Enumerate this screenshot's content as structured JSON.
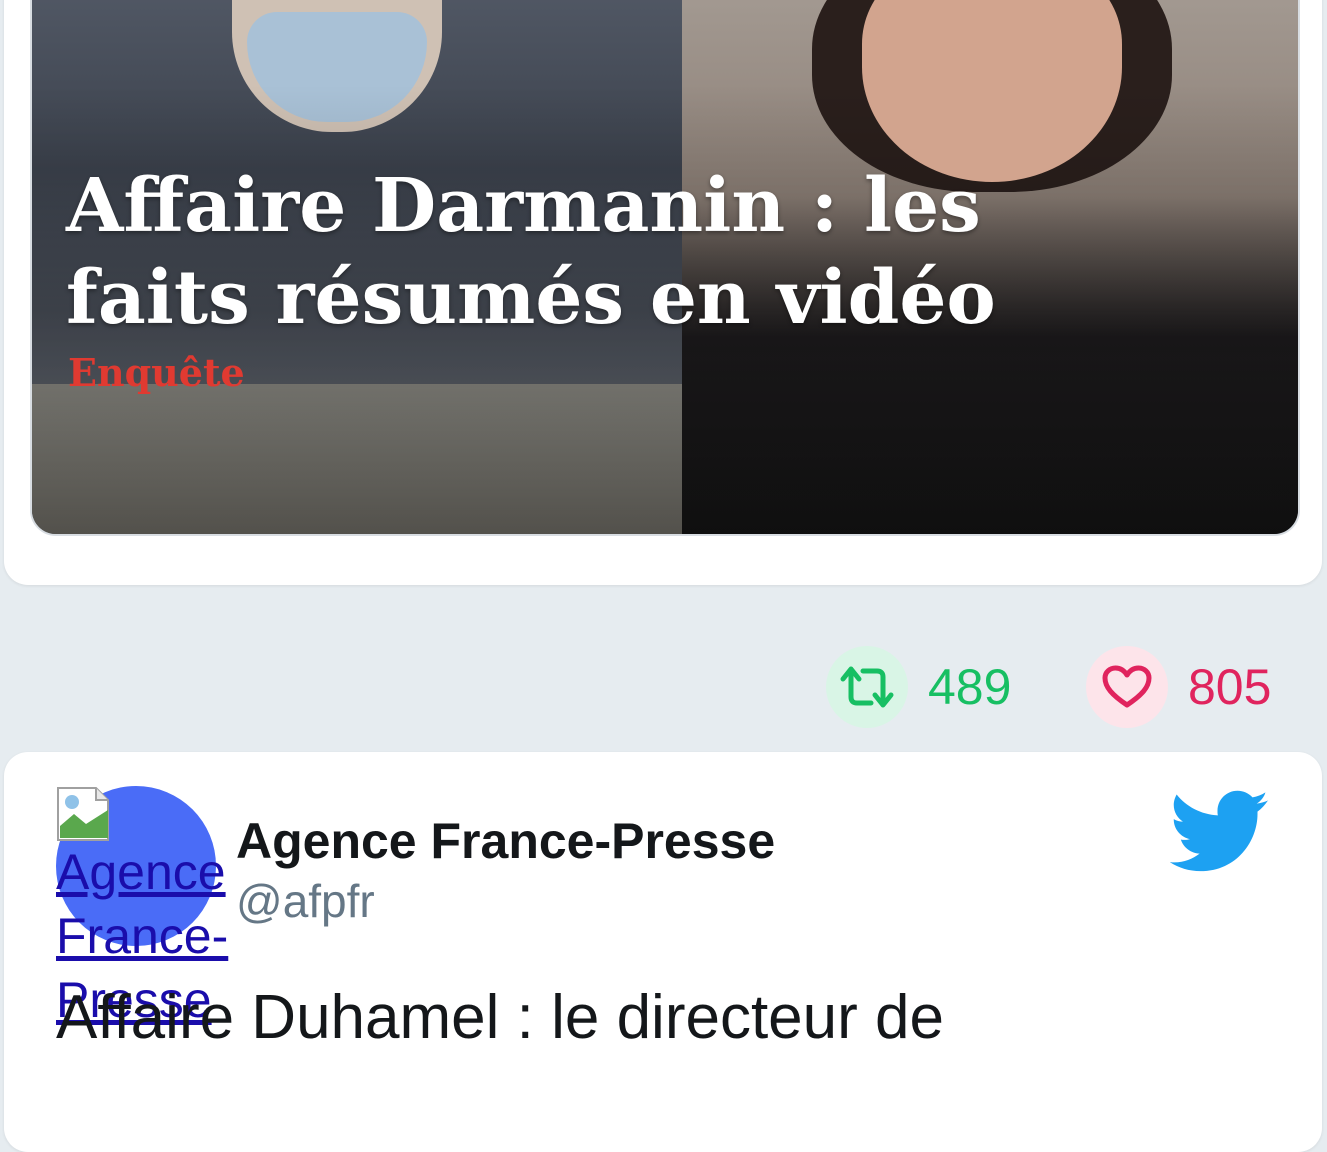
{
  "media": {
    "title": "Affaire Darmanin : les faits résumés en vidéo",
    "tag": "Enquête"
  },
  "actions": {
    "retweet_count": "489",
    "like_count": "805"
  },
  "tweet": {
    "avatar_alt": "Agence France-Presse",
    "author_name": "Agence France-Presse",
    "author_handle": "@afpfr",
    "text": "Affaire Duhamel : le directeur de"
  },
  "colors": {
    "retweet": "#17bf63",
    "like": "#e0245e",
    "twitter_blue": "#1da1f2",
    "background": "#e6ecf0"
  },
  "icons": {
    "retweet": "retweet-icon",
    "like": "heart-icon",
    "brand": "twitter-bird-icon",
    "broken_image": "broken-image-icon"
  }
}
